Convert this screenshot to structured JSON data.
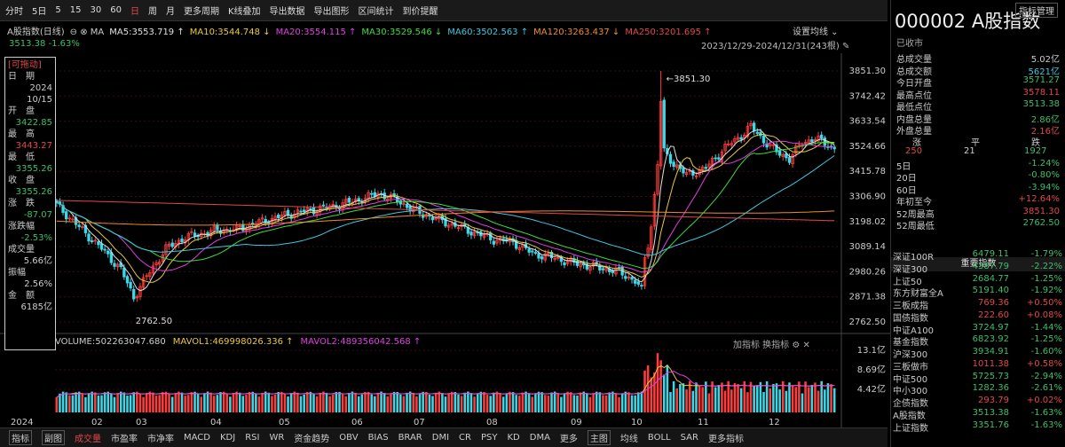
{
  "toolbar": {
    "items": [
      "分时",
      "5日",
      "5",
      "15",
      "30",
      "60",
      "日",
      "周",
      "月",
      "更多周期",
      "K线叠加",
      "导出数据",
      "导出图形",
      "区间统计",
      "到价提醒"
    ],
    "active": 6
  },
  "ma_line": {
    "index_name": "A股指数(日线)",
    "items": [
      {
        "label": "MA5:3553.719",
        "color": "#e0e0e0"
      },
      {
        "label": "MA10:3544.748",
        "color": "#e8c840"
      },
      {
        "label": "MA20:3554.115",
        "color": "#e040e0"
      },
      {
        "label": "MA30:3529.546",
        "color": "#3cdc3c"
      },
      {
        "label": "MA60:3502.563",
        "color": "#3cc8e0"
      },
      {
        "label": "MA120:3263.437",
        "color": "#f08c28"
      },
      {
        "label": "MA250:3201.695",
        "color": "#e04848"
      }
    ]
  },
  "last_info": "3513.38 -1.63%",
  "settings_label": "设置均线",
  "date_range": "2023/12/29-2024/12/31(243根)",
  "datapanel": {
    "title": "[可拖动]",
    "rows": [
      {
        "t": "日　期",
        "v": "2024",
        "v2": "10/15",
        "vc": "#ccc"
      },
      {
        "t": "开　盘",
        "v": "3422.85",
        "vc": "#3cbf6b"
      },
      {
        "t": "最　高",
        "v": "3443.27",
        "vc": "#e04848"
      },
      {
        "t": "最　低",
        "v": "3355.26",
        "vc": "#3cbf6b"
      },
      {
        "t": "收　盘",
        "v": "3355.26",
        "vc": "#3cbf6b"
      },
      {
        "t": "涨　跌",
        "v": "-87.07",
        "vc": "#3cbf6b"
      },
      {
        "t": "涨跌幅",
        "v": "-2.53%",
        "vc": "#3cbf6b"
      },
      {
        "t": "成交量",
        "v": "5.66亿",
        "vc": "#ccc"
      },
      {
        "t": "振幅",
        "v": "2.56%",
        "vc": "#ccc"
      },
      {
        "t": "金　额",
        "v": "6185亿",
        "vc": "#ccc"
      }
    ]
  },
  "yaxis_labels": [
    "3851.30",
    "3742.42",
    "3633.54",
    "3524.66",
    "3415.78",
    "3306.90",
    "3198.02",
    "3089.14",
    "2980.26",
    "2871.38",
    "2762.50"
  ],
  "vol_axis": [
    "13.1亿",
    "8.69亿",
    "4.42亿"
  ],
  "xlabels": [
    "2024",
    "02",
    "03",
    "04",
    "05",
    "06",
    "07",
    "08",
    "09",
    "10",
    "11",
    "12"
  ],
  "annot": {
    "high": "3851.30",
    "low": "2762.50"
  },
  "volume_info": [
    {
      "label": "VOLUME:502263047.680",
      "color": "#ccc"
    },
    {
      "label": "MAVOL1:469998026.336",
      "color": "#e8c840"
    },
    {
      "label": "MAVOL2:489356042.568",
      "color": "#e040e0"
    }
  ],
  "vol_tools": "加指标  换指标",
  "sidebar": {
    "code": "000002 A股指数",
    "status": "已收市",
    "rows": [
      {
        "l": "总成交量",
        "r": "5.02亿",
        "c": "#ccc"
      },
      {
        "l": "总成交额",
        "r": "5621亿",
        "c": "#3cc8e0"
      },
      {
        "l": "今日开盘",
        "r": "3571.27",
        "c": "#3cbf6b"
      },
      {
        "l": "最高点位",
        "r": "3578.11",
        "c": "#e04848"
      },
      {
        "l": "最低点位",
        "r": "3513.38",
        "c": "#3cbf6b"
      },
      {
        "l": "内盘总量",
        "r": "2.86亿",
        "c": "#3cbf6b"
      },
      {
        "l": "外盘总量",
        "r": "2.16亿",
        "c": "#e04848"
      }
    ],
    "updown": {
      "labels": [
        "涨",
        "平",
        "跌"
      ],
      "values": [
        "250",
        "21",
        "1927"
      ],
      "colors": [
        "#e04848",
        "#ccc",
        "#3cbf6b"
      ]
    },
    "perf": [
      {
        "l": "5日",
        "r": "-1.24%",
        "c": "#3cbf6b"
      },
      {
        "l": "20日",
        "r": "-0.80%",
        "c": "#3cbf6b"
      },
      {
        "l": "60日",
        "r": "-3.94%",
        "c": "#3cbf6b"
      },
      {
        "l": "年初至今",
        "r": "+12.64%",
        "c": "#e04848"
      },
      {
        "l": "52周最高",
        "r": "3851.30",
        "c": "#e04848"
      },
      {
        "l": "52周最低",
        "r": "2762.50",
        "c": "#3cbf6b"
      }
    ],
    "section_title": "重要指数",
    "indices": [
      {
        "n": "深证100R",
        "p": "6479.11",
        "c": "-1.79%",
        "d": "dn"
      },
      {
        "n": "深证300",
        "p": "4387.79",
        "c": "-2.22%",
        "d": "dn"
      },
      {
        "n": "上证50",
        "p": "2684.77",
        "c": "-1.25%",
        "d": "dn"
      },
      {
        "n": "东方财富全A",
        "p": "5191.40",
        "c": "-1.92%",
        "d": "dn"
      },
      {
        "n": "三板成指",
        "p": "769.36",
        "c": "+0.50%",
        "d": "up"
      },
      {
        "n": "国债指数",
        "p": "222.60",
        "c": "+0.08%",
        "d": "up"
      },
      {
        "n": "中证A100",
        "p": "3724.97",
        "c": "-1.44%",
        "d": "dn"
      },
      {
        "n": "基金指数",
        "p": "6823.92",
        "c": "-1.25%",
        "d": "dn"
      },
      {
        "n": "沪深300",
        "p": "3934.91",
        "c": "-1.60%",
        "d": "dn"
      },
      {
        "n": "三板做市",
        "p": "1011.38",
        "c": "+0.58%",
        "d": "up"
      },
      {
        "n": "中证500",
        "p": "5725.73",
        "c": "-2.94%",
        "d": "dn"
      },
      {
        "n": "中小300",
        "p": "1282.36",
        "c": "-2.61%",
        "d": "dn"
      },
      {
        "n": "企债指数",
        "p": "293.79",
        "c": "+0.02%",
        "d": "up"
      },
      {
        "n": "A股指数",
        "p": "3513.38",
        "c": "-1.63%",
        "d": "dn"
      },
      {
        "n": "上证指数",
        "p": "3351.76",
        "c": "-1.63%",
        "d": "dn"
      }
    ]
  },
  "bottom": {
    "items": [
      "指标",
      "副图",
      "成交量",
      "市盈率",
      "市净率",
      "MACD",
      "KDJ",
      "RSI",
      "WR",
      "资金趋势",
      "OBV",
      "BIAS",
      "BRAR",
      "DMI",
      "CR",
      "PSY",
      "KD",
      "DMA",
      "更多",
      "主图",
      "均线",
      "BOLL",
      "SAR",
      "更多指标"
    ],
    "active": 2,
    "right": "指标管理"
  },
  "chart_data": {
    "type": "candlestick",
    "title": "A股指数(日线)",
    "period": "2023/12/29-2024/12/31",
    "ylim": [
      2762.5,
      3851.3
    ],
    "x_ticks": [
      "2024",
      "02",
      "03",
      "04",
      "05",
      "06",
      "07",
      "08",
      "09",
      "10",
      "11",
      "12"
    ],
    "close_anchors": [
      [
        0,
        3270
      ],
      [
        8,
        3160
      ],
      [
        14,
        3080
      ],
      [
        20,
        2990
      ],
      [
        24,
        2870
      ],
      [
        28,
        2960
      ],
      [
        34,
        3080
      ],
      [
        40,
        3130
      ],
      [
        50,
        3160
      ],
      [
        56,
        3165
      ],
      [
        62,
        3190
      ],
      [
        72,
        3230
      ],
      [
        80,
        3250
      ],
      [
        88,
        3270
      ],
      [
        96,
        3300
      ],
      [
        100,
        3320
      ],
      [
        106,
        3290
      ],
      [
        112,
        3240
      ],
      [
        118,
        3210
      ],
      [
        124,
        3180
      ],
      [
        130,
        3150
      ],
      [
        136,
        3120
      ],
      [
        142,
        3110
      ],
      [
        148,
        3060
      ],
      [
        155,
        3040
      ],
      [
        160,
        3020
      ],
      [
        168,
        3000
      ],
      [
        175,
        2980
      ],
      [
        180,
        2940
      ],
      [
        182,
        2900
      ],
      [
        183,
        3040
      ],
      [
        184,
        3100
      ],
      [
        185,
        3180
      ],
      [
        186,
        3310
      ],
      [
        187,
        3450
      ],
      [
        188,
        3720
      ],
      [
        189,
        3500
      ],
      [
        192,
        3450
      ],
      [
        196,
        3400
      ],
      [
        202,
        3430
      ],
      [
        208,
        3520
      ],
      [
        212,
        3560
      ],
      [
        216,
        3610
      ],
      [
        220,
        3550
      ],
      [
        224,
        3500
      ],
      [
        228,
        3470
      ],
      [
        232,
        3540
      ],
      [
        236,
        3560
      ],
      [
        240,
        3530
      ],
      [
        242,
        3513.38
      ]
    ],
    "high_point": {
      "label": "3851.30",
      "value": 3851.3
    },
    "low_point": {
      "label": "2762.50",
      "value": 2762.5
    },
    "ma_last": {
      "MA5": 3553.719,
      "MA10": 3544.748,
      "MA20": 3554.115,
      "MA30": 3529.546,
      "MA60": 3502.563,
      "MA120": 3263.437,
      "MA250": 3201.695
    },
    "volume": {
      "last": 502263047.68,
      "mavol1": 469998026.336,
      "mavol2": 489356042.568,
      "axis": [
        "13.1亿",
        "8.69亿",
        "4.42亿"
      ]
    }
  }
}
